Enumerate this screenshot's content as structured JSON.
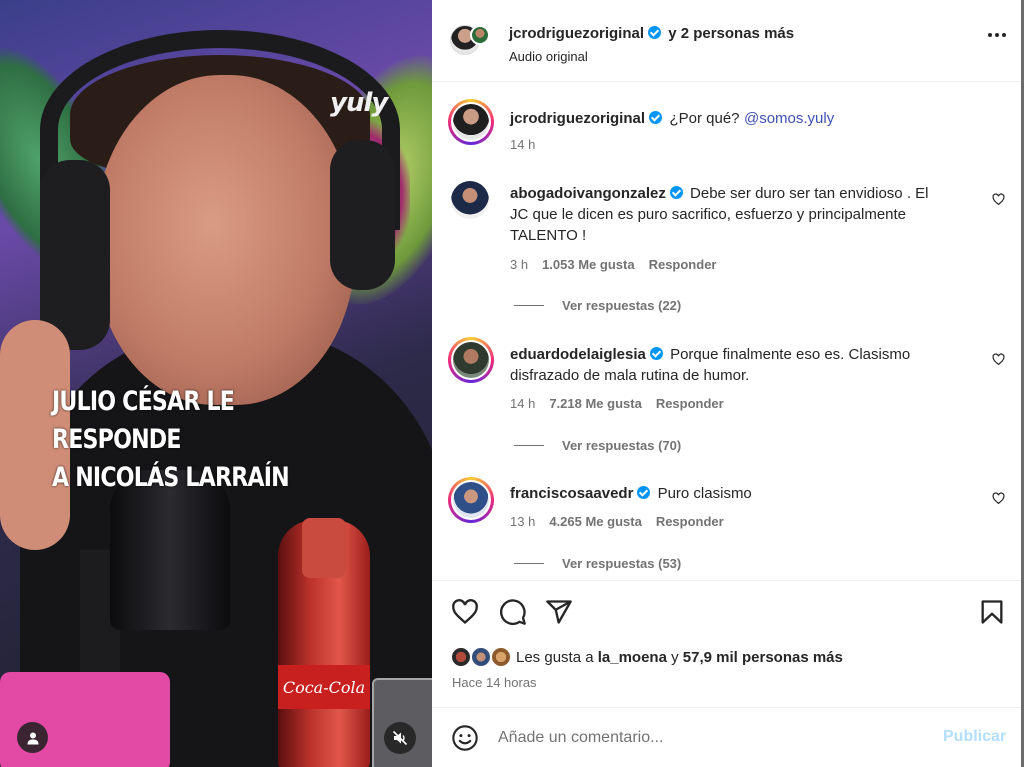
{
  "media": {
    "brand": "yuly",
    "caption_line1": "JULIO CÉSAR LE RESPONDE",
    "caption_line2": "A NICOLÁS LARRAÍN",
    "bottle_label": "Coca-Cola",
    "icons": [
      "user-tag-icon",
      "mute-icon"
    ]
  },
  "header": {
    "username": "jcrodriguezoriginal",
    "collab_text": "y 2 personas más",
    "audio": "Audio original",
    "more_icon": "more-options-icon"
  },
  "caption": {
    "username": "jcrodriguezoriginal",
    "text": "¿Por qué?",
    "mention": "@somos.yuly",
    "time": "14 h"
  },
  "comments": [
    {
      "username": "abogadoivangonzalez",
      "text_line1": "Debe ser duro ser tan envidioso . El",
      "text_line2": "JC que le dicen es puro sacrifico, esfuerzo y principalmente",
      "text_line3": "TALENTO !",
      "time": "3 h",
      "likes": "1.053 Me gusta",
      "reply": "Responder",
      "view_replies": "Ver respuestas (22)"
    },
    {
      "username": "eduardodelaiglesia",
      "text_line1": "Porque finalmente eso es. Clasismo",
      "text_line2": "disfrazado de mala rutina de humor.",
      "time": "14 h",
      "likes": "7.218 Me gusta",
      "reply": "Responder",
      "view_replies": "Ver respuestas (70)"
    },
    {
      "username": "franciscosaavedr",
      "text_line1": "Puro clasismo",
      "time": "13 h",
      "likes": "4.265 Me gusta",
      "reply": "Responder",
      "view_replies": "Ver respuestas (53)"
    }
  ],
  "likes": {
    "prefix": "Les gusta a",
    "user": "la_moena",
    "conj": "y",
    "others": "57,9 mil personas más"
  },
  "posted": "Hace 14 horas",
  "comment_box": {
    "placeholder": "Añade un comentario...",
    "publish": "Publicar"
  },
  "colors": {
    "verified": "#0095f6",
    "muted_text": "#737373",
    "publish_disabled": "#b2dffc",
    "mention": "#3f51b5"
  }
}
